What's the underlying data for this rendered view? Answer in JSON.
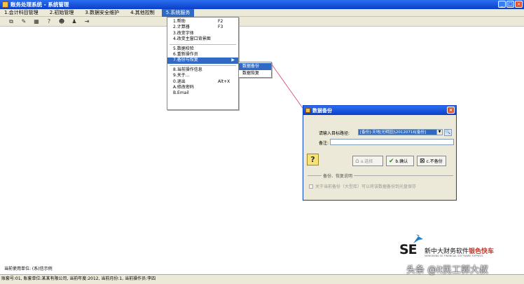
{
  "window": {
    "title": "账务处理系统 - 系统管理",
    "buttons": [
      "minimize",
      "maximize",
      "close"
    ]
  },
  "menubar": {
    "items": [
      {
        "label": "1.会计科目管理",
        "active": false
      },
      {
        "label": "2.初始管理",
        "active": false
      },
      {
        "label": "3.数据安全维护",
        "active": false
      },
      {
        "label": "4.其他控制",
        "active": false
      },
      {
        "label": "5.系统服务",
        "active": true
      }
    ]
  },
  "toolbar": {
    "icons": [
      "copy-icon",
      "paste-icon",
      "grid-icon",
      "help-icon",
      "user-icon",
      "user-add-icon",
      "exit-icon"
    ]
  },
  "dropdown": {
    "groups": [
      [
        {
          "label": "1.帮助",
          "shortcut": "F2"
        },
        {
          "label": "2.计算器",
          "shortcut": "F3"
        },
        {
          "label": "3.改变字体",
          "shortcut": ""
        },
        {
          "label": "4.改变主窗口背景图",
          "shortcut": ""
        }
      ],
      [
        {
          "label": "5.数据校验",
          "shortcut": ""
        },
        {
          "label": "6.重新操作员",
          "shortcut": ""
        },
        {
          "label": "7.备份与恢复",
          "shortcut": "",
          "submenu": true,
          "active": true
        }
      ],
      [
        {
          "label": "8.当前操作信息",
          "shortcut": ""
        },
        {
          "label": "9.关于...",
          "shortcut": ""
        },
        {
          "label": "0.退出",
          "shortcut": "Alt+X"
        },
        {
          "label": "A.修改密码",
          "shortcut": ""
        },
        {
          "label": "B.Email",
          "shortcut": ""
        }
      ]
    ],
    "submenu_arrow": "▶"
  },
  "submenu": {
    "items": [
      {
        "label": "数据备份",
        "active": true
      },
      {
        "label": "数据恢复",
        "active": false
      }
    ]
  },
  "dialog": {
    "title": "数据备份",
    "path_label": "请输入目标路径:",
    "path_value": "[备份]-天地[光明园]\\20120716[备份]",
    "note_label": "备注:",
    "note_value": "",
    "buttons": {
      "browse_disabled": "a.选择",
      "confirm": "b.确认",
      "cancel": "c.不备份"
    },
    "group_title": "备份、恢复说明",
    "checkbox_label": "关于当前备份（大型库）可以将该数据备份到光盘保存"
  },
  "user_line": "当前使用单位: (系)信示例",
  "statusbar": "账套号:01, 账套单位:某某有限公司, 当前年度:2012, 当前月份:1, 当前操作员:李四",
  "logo": {
    "brand_letters": "SE",
    "name_black": "新中大财务软件",
    "name_red": "银色快车",
    "sub": "NEWGRAND SE FINANCIAL SOFTWARE EXPRESS"
  },
  "watermark": "头条 @it民工郭大叔",
  "colors": {
    "title_bar": "#0a3fc8",
    "menu_bg": "#ece9d8",
    "highlight": "#316ac5",
    "close_red": "#e0502a",
    "connector": "#d0406a"
  }
}
